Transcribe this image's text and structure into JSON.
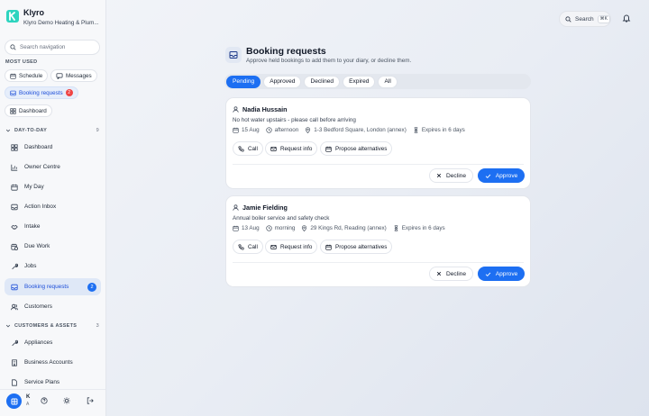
{
  "app": {
    "name": "Klyro",
    "account": "Klyro Demo Heating & Plum..."
  },
  "sidebar": {
    "search_placeholder": "Search navigation",
    "most_used_label": "MOST USED",
    "most_used": [
      {
        "label": "Schedule",
        "icon": "calendar-icon"
      },
      {
        "label": "Messages",
        "icon": "chat-icon"
      },
      {
        "label": "Booking requests",
        "icon": "inbox-icon",
        "badge": "2"
      },
      {
        "label": "Dashboard",
        "icon": "grid-icon"
      }
    ],
    "groups": [
      {
        "label": "DAY-TO-DAY",
        "count": "9",
        "items": [
          {
            "label": "Dashboard",
            "icon": "grid-icon"
          },
          {
            "label": "Owner Centre",
            "icon": "chart-icon"
          },
          {
            "label": "My Day",
            "icon": "calendar-icon"
          },
          {
            "label": "Action Inbox",
            "icon": "inbox-icon"
          },
          {
            "label": "Intake",
            "icon": "handshake-icon"
          },
          {
            "label": "Due Work",
            "icon": "calendar-clock-icon"
          },
          {
            "label": "Jobs",
            "icon": "wrench-icon"
          },
          {
            "label": "Booking requests",
            "icon": "inbox-icon",
            "badge": "2"
          },
          {
            "label": "Customers",
            "icon": "users-icon"
          }
        ]
      },
      {
        "label": "CUSTOMERS & ASSETS",
        "count": "3",
        "items": [
          {
            "label": "Appliances",
            "icon": "tool-icon"
          },
          {
            "label": "Business Accounts",
            "icon": "building-icon"
          },
          {
            "label": "Service Plans",
            "icon": "file-icon"
          }
        ]
      }
    ],
    "user": {
      "initial": "K",
      "sub": "A"
    }
  },
  "topbar": {
    "search_label": "Search",
    "shortcut": "⌘K"
  },
  "page": {
    "title": "Booking requests",
    "subtitle": "Approve held bookings to add them to your diary, or decline them."
  },
  "tabs": [
    {
      "label": "Pending",
      "active": true
    },
    {
      "label": "Approved",
      "active": false
    },
    {
      "label": "Declined",
      "active": false
    },
    {
      "label": "Expired",
      "active": false
    },
    {
      "label": "All",
      "active": false
    }
  ],
  "requests": [
    {
      "name": "Nadia Hussain",
      "note": "No hot water upstairs - please call before arriving",
      "date": "15 Aug",
      "slot": "afternoon",
      "address": "1-3 Bedford Square, London (annex)",
      "expires": "Expires in 6 days"
    },
    {
      "name": "Jamie Fielding",
      "note": "Annual boiler service and safety check",
      "date": "13 Aug",
      "slot": "morning",
      "address": "29 Kings Rd, Reading (annex)",
      "expires": "Expires in 6 days"
    }
  ],
  "actions": {
    "call": "Call",
    "request_info": "Request info",
    "propose": "Propose alternatives",
    "decline": "Decline",
    "approve": "Approve"
  }
}
